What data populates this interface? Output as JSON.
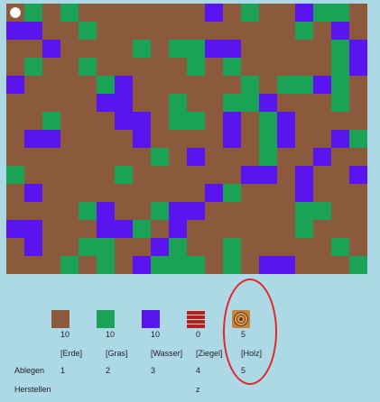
{
  "colors": {
    "erde": "#8b5a3c",
    "gras": "#1aa356",
    "wasser": "#5a14f0",
    "background": "#add8e6",
    "highlight": "#e0262a"
  },
  "legend": {
    "map": {
      "E": "erde",
      "G": "gras",
      "W": "wasser"
    }
  },
  "map_rows": [
    "EGEGEEEEEEEWEGEEWGGE",
    "WWEEGEEEEEEEEEEEGEWE",
    "EEWEEEEGEGGWWEEEEEGW",
    "EGEEGEEEEEGEGEEEEEGW",
    "WEEEEGWEEEEEEGEGGWGE",
    "EEEEEWWEEGEEGGWEEEGE",
    "EEGEEEWWEGGEWEGWEEEE",
    "EWWEEEEWEEEEWEGWEEWG",
    "EEEEEEEEGEWEEEGEEWEE",
    "GEEEEEGEEEEEEWWEWEEW",
    "EWEEEEEEEEEWGEEEWEEE",
    "EEEEGWEEGWWEEEEEGGEE",
    "WWEEEWWGEWEEEEEEGEEE",
    "EWEEGGEEWGEEGEEEEEGE",
    "EEEGEGEWGGGEGEWWEEEG"
  ],
  "inventory": {
    "slots": [
      {
        "name": "Erde",
        "count": "10",
        "label": "[Erde]",
        "ablegen": "1",
        "herstellen": ""
      },
      {
        "name": "Gras",
        "count": "10",
        "label": "[Gras]",
        "ablegen": "2",
        "herstellen": ""
      },
      {
        "name": "Wasser",
        "count": "10",
        "label": "[Wasser]",
        "ablegen": "3",
        "herstellen": ""
      },
      {
        "name": "Ziegel",
        "count": "0",
        "label": "[Ziegel]",
        "ablegen": "4",
        "herstellen": "z"
      },
      {
        "name": "Holz",
        "count": "5",
        "label": "[Holz]",
        "ablegen": "5",
        "herstellen": ""
      }
    ],
    "row_labels": {
      "ablegen": "Ablegen",
      "herstellen": "Herstellen"
    }
  }
}
